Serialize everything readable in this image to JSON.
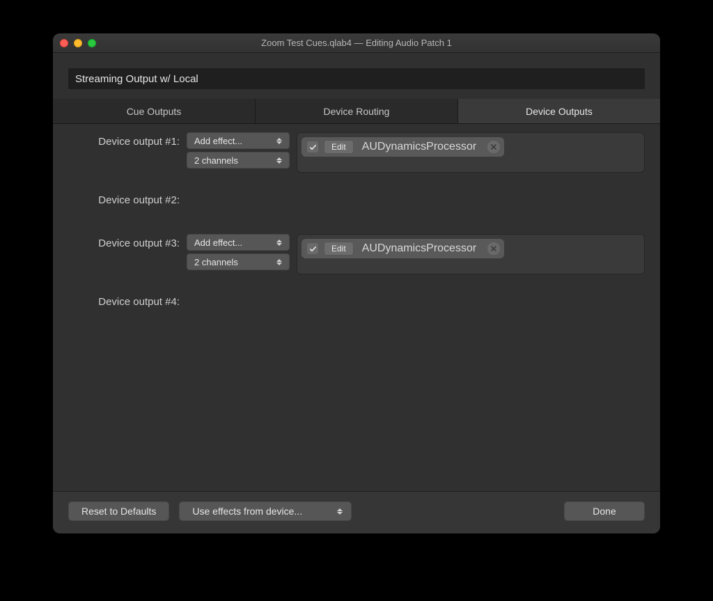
{
  "window": {
    "title": "Zoom Test Cues.qlab4 — Editing Audio Patch 1"
  },
  "patch_name": "Streaming Output w/ Local",
  "tabs": [
    {
      "label": "Cue Outputs",
      "active": false
    },
    {
      "label": "Device Routing",
      "active": false
    },
    {
      "label": "Device Outputs",
      "active": true
    }
  ],
  "outputs": [
    {
      "label": "Device output #1:",
      "add_effect_label": "Add effect...",
      "channels_label": "2 channels",
      "effects": [
        {
          "enabled": true,
          "edit_label": "Edit",
          "name": "AUDynamicsProcessor"
        }
      ]
    },
    {
      "label": "Device output #2:",
      "add_effect_label": "",
      "channels_label": "",
      "effects": []
    },
    {
      "label": "Device output #3:",
      "add_effect_label": "Add effect...",
      "channels_label": "2 channels",
      "effects": [
        {
          "enabled": true,
          "edit_label": "Edit",
          "name": "AUDynamicsProcessor"
        }
      ]
    },
    {
      "label": "Device output #4:",
      "add_effect_label": "",
      "channels_label": "",
      "effects": []
    }
  ],
  "footer": {
    "reset_label": "Reset to Defaults",
    "use_effects_label": "Use effects from device...",
    "done_label": "Done"
  }
}
